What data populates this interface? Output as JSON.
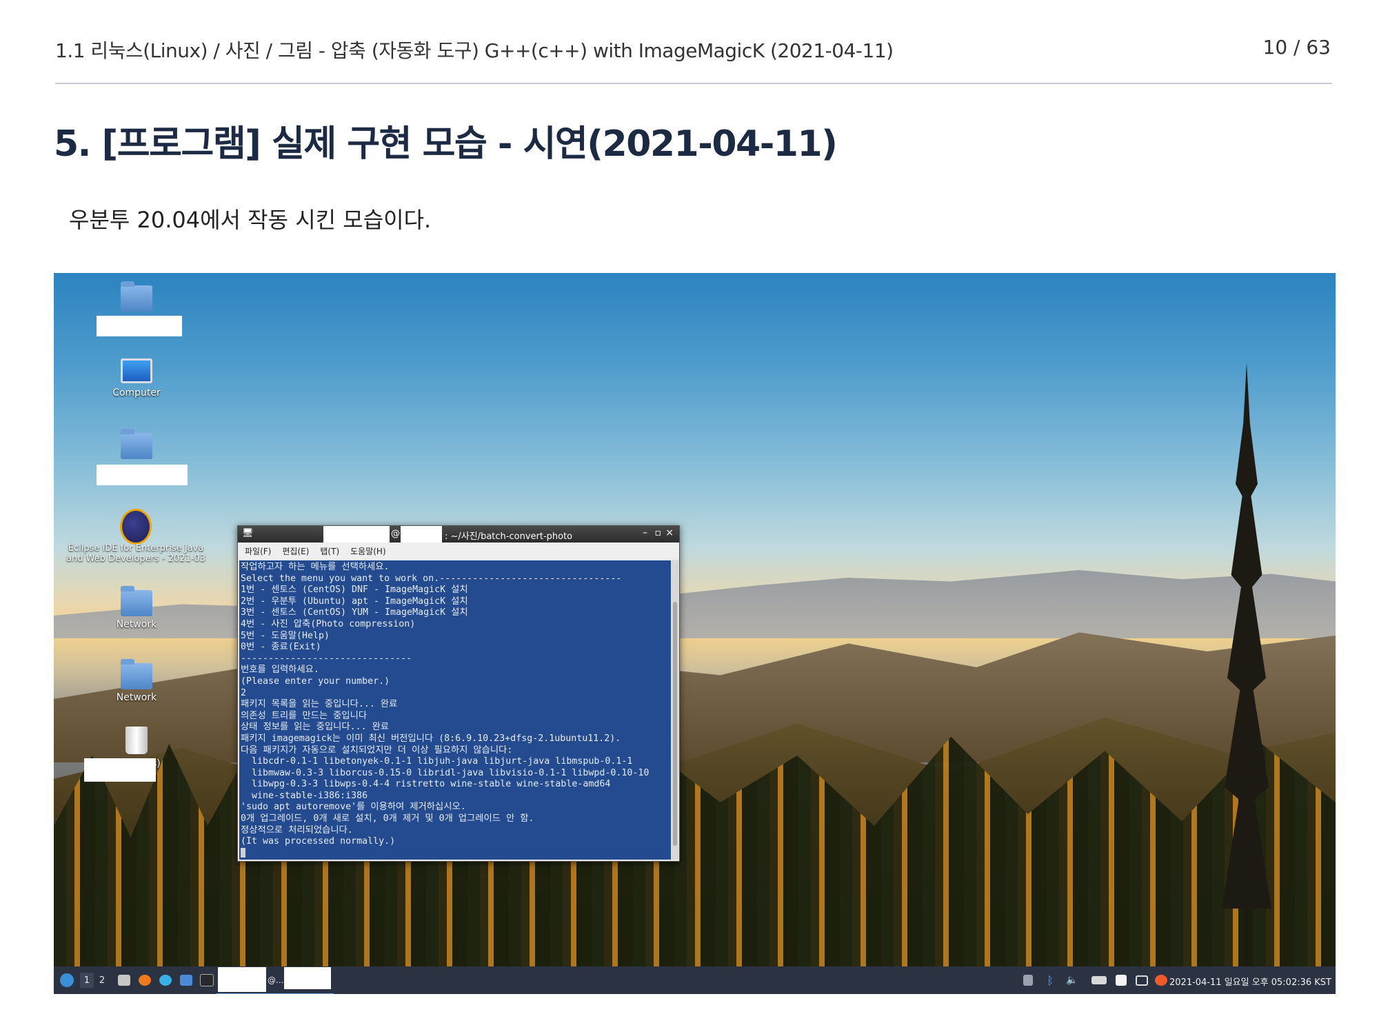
{
  "header": {
    "doc_title": "1.1 리눅스(Linux) / 사진 / 그림 - 압축 (자동화 도구) G++(c++) with ImageMagicK (2021-04-11)",
    "page": "10 / 63"
  },
  "section": {
    "title": "5. [프로그램] 실제 구현 모습 - 시연(2021-04-11)",
    "subtitle": "우분투 20.04에서 작동 시킨 모습이다."
  },
  "desktop": {
    "icons": {
      "computer": "Computer",
      "eclipse": "Eclipse IDE for Enterprise Java and Web Developers - 2021-03",
      "network1": "Network",
      "network2": "Network",
      "trash_suffix": "s)"
    }
  },
  "terminal": {
    "title_at": "@",
    "title_path": ": ~/사진/batch-convert-photo",
    "menu": {
      "file": "파일(F)",
      "edit": "편집(E)",
      "tab": "탭(T)",
      "help": "도움말(H)"
    },
    "lines": [
      "작업하고자 하는 메뉴를 선택하세요.",
      "Select the menu you want to work on.---------------------------------",
      "1번 - 센토스 (CentOS) DNF - ImageMagicK 설치",
      "2번 - 우분투 (Ubuntu) apt - ImageMagicK 설치",
      "3번 - 센토스 (CentOS) YUM - ImageMagicK 설치",
      "4번 - 사진 압축(Photo compression)",
      "5번 - 도움말(Help)",
      "0번 - 종료(Exit)",
      "-------------------------------",
      "번호를 입력하세요.",
      "(Please enter your number.)",
      "2",
      "패키지 목록을 읽는 중입니다... 완료",
      "의존성 트리를 만드는 중입니다",
      "상태 정보를 읽는 중입니다... 완료",
      "패키지 imagemagick는 이미 최신 버전입니다 (8:6.9.10.23+dfsg-2.1ubuntu11.2).",
      "다음 패키지가 자동으로 설치되었지만 더 이상 필요하지 않습니다:",
      "  libcdr-0.1-1 libetonyek-0.1-1 libjuh-java libjurt-java libmspub-0.1-1",
      "  libmwaw-0.3-3 liborcus-0.15-0 libridl-java libvisio-0.1-1 libwpd-0.10-10",
      "  libwpg-0.3-3 libwps-0.4-4 ristretto wine-stable wine-stable-amd64",
      "  wine-stable-i386:i386",
      "'sudo apt autoremove'를 이용하여 제거하십시오.",
      "0개 업그레이드, 0개 새로 설치, 0개 제거 및 0개 업그레이드 안 함.",
      "정상적으로 처리되었습니다.",
      "(It was processed normally.)"
    ]
  },
  "taskbar": {
    "workspace1": "1",
    "workspace2": "2",
    "task_label": "@...",
    "clock": "2021-04-11 일요일 오후 05:02:36 KST"
  }
}
